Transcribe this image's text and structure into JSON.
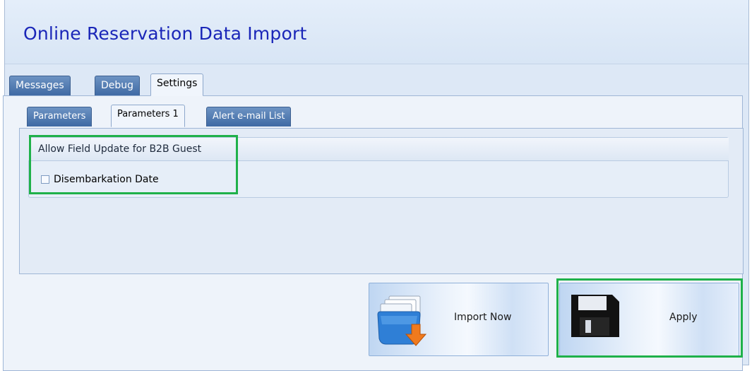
{
  "window": {
    "title": "Online Reservation Data Import"
  },
  "tabs": [
    {
      "label": "Messages",
      "active": false
    },
    {
      "label": "Debug",
      "active": false
    },
    {
      "label": "Settings",
      "active": true
    }
  ],
  "sub_tabs": [
    {
      "label": "Parameters",
      "active": false
    },
    {
      "label": "Parameters 1",
      "active": true
    },
    {
      "label": "Alert e-mail List",
      "active": false
    }
  ],
  "group": {
    "title": "Allow Field Update for B2B Guest",
    "checkbox_label": "Disembarkation Date",
    "checked": false
  },
  "buttons": {
    "import_label": "Import Now",
    "import_icon": "folder-import-icon",
    "apply_label": "Apply",
    "apply_icon": "floppy-disk-icon"
  },
  "colors": {
    "title": "#1a26b8",
    "highlight": "#1fb14a",
    "tab_inactive": "#4f78b0",
    "panel": "#e3ebf6"
  }
}
